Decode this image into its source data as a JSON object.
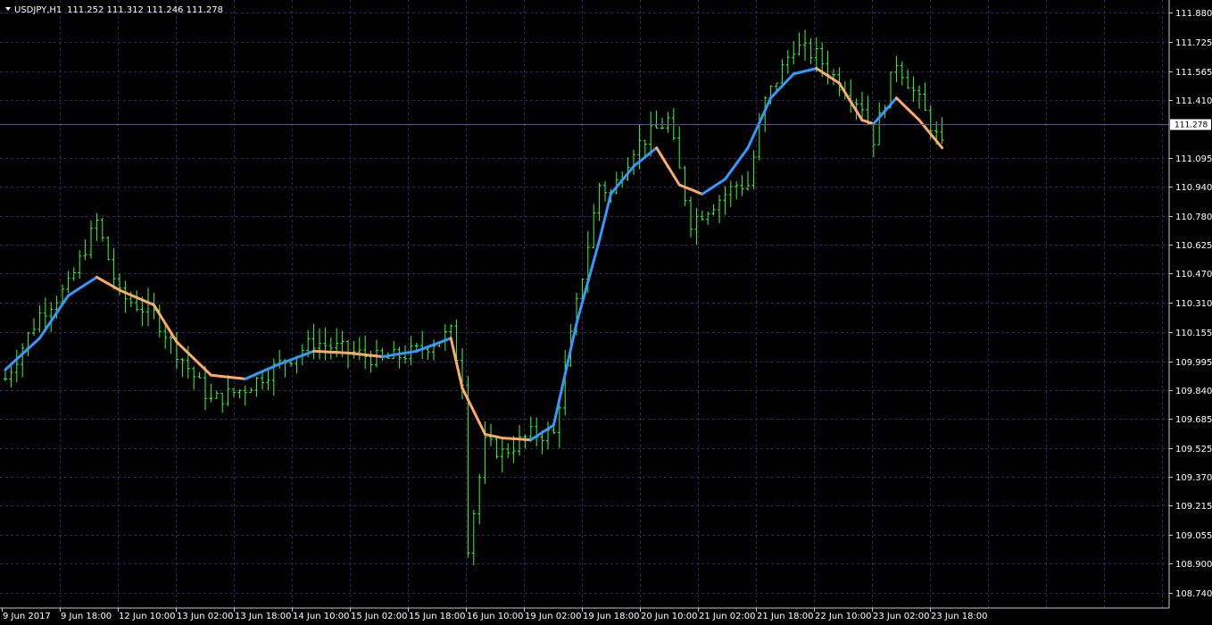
{
  "window": {
    "title": "USDJPY,H1",
    "ohlc": "111.252 111.312 111.246 111.278"
  },
  "colors": {
    "background": "#000000",
    "grid": "#3a1f66",
    "candle": "#33ff33",
    "ma_up": "#3399ff",
    "ma_down": "#ffaa66",
    "price_line": "#6a4aa0",
    "text": "#ffffff"
  },
  "chart_data": {
    "type": "line",
    "symbol": "USDJPY",
    "timeframe": "H1",
    "grid": true,
    "current_price": 111.278,
    "ylim": [
      108.66,
      111.95
    ],
    "y_ticks": [
      "111.880",
      "111.725",
      "111.565",
      "111.410",
      "111.095",
      "110.940",
      "110.780",
      "110.625",
      "110.470",
      "110.310",
      "110.155",
      "109.995",
      "109.840",
      "109.685",
      "109.525",
      "109.370",
      "109.215",
      "109.055",
      "108.900",
      "108.740"
    ],
    "x_ticks": [
      "9 Jun 2017",
      "9 Jun 18:00",
      "12 Jun 10:00",
      "13 Jun 02:00",
      "13 Jun 18:00",
      "14 Jun 10:00",
      "15 Jun 02:00",
      "15 Jun 18:00",
      "16 Jun 10:00",
      "19 Jun 02:00",
      "19 Jun 18:00",
      "20 Jun 10:00",
      "21 Jun 02:00",
      "21 Jun 18:00",
      "22 Jun 10:00",
      "23 Jun 02:00",
      "23 Jun 18:00"
    ],
    "bar_count": 164,
    "series": [
      {
        "kind": "ohlc-bars",
        "x": [
          0,
          6,
          11,
          16,
          20,
          26,
          30,
          36,
          42,
          48,
          54,
          60,
          66,
          72,
          78,
          80,
          81,
          84,
          87,
          92,
          96,
          100,
          104,
          106,
          110,
          116,
          120,
          124,
          128,
          130,
          133,
          138,
          142,
          146,
          150,
          152,
          156,
          160,
          164
        ],
        "close": [
          109.9,
          110.25,
          110.4,
          110.75,
          110.35,
          110.25,
          110.05,
          109.78,
          109.85,
          109.98,
          110.1,
          110.05,
          110.0,
          110.05,
          110.15,
          109.9,
          109.0,
          109.55,
          109.5,
          109.6,
          109.6,
          110.3,
          110.95,
          110.9,
          111.15,
          111.3,
          110.75,
          110.85,
          110.95,
          110.95,
          111.4,
          111.7,
          111.65,
          111.5,
          111.38,
          111.2,
          111.62,
          111.4,
          111.15
        ]
      },
      {
        "kind": "moving-average",
        "x": [
          0,
          6,
          11,
          16,
          20,
          26,
          30,
          36,
          42,
          48,
          54,
          60,
          66,
          72,
          78,
          80,
          84,
          87,
          92,
          96,
          100,
          104,
          106,
          110,
          114,
          118,
          122,
          126,
          130,
          134,
          138,
          142,
          146,
          150,
          152,
          156,
          160,
          164
        ],
        "values": [
          109.95,
          110.12,
          110.35,
          110.45,
          110.38,
          110.3,
          110.1,
          109.92,
          109.9,
          109.98,
          110.05,
          110.04,
          110.02,
          110.05,
          110.12,
          109.85,
          109.6,
          109.58,
          109.57,
          109.65,
          110.2,
          110.65,
          110.9,
          111.05,
          111.15,
          110.95,
          110.9,
          110.98,
          111.15,
          111.42,
          111.55,
          111.58,
          111.5,
          111.3,
          111.28,
          111.42,
          111.3,
          111.15
        ]
      }
    ]
  }
}
